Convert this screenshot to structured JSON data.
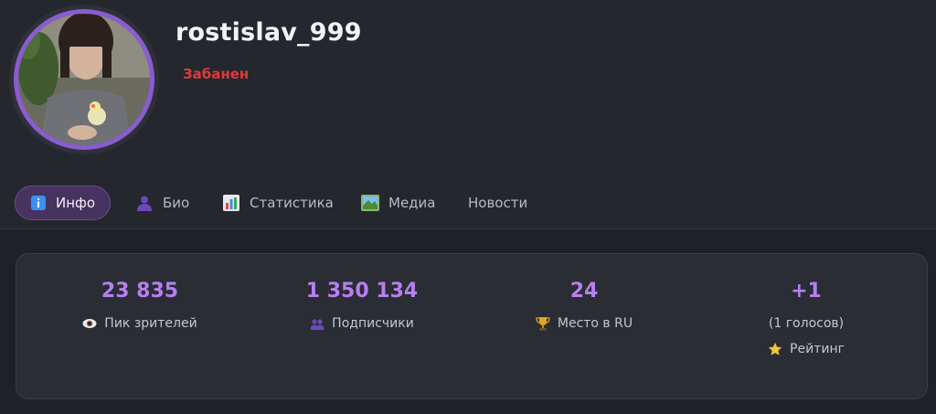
{
  "profile": {
    "username": "rostislav_999",
    "status": "Забанен",
    "status_color": "#e03a3a",
    "accent_color": "#8a5cd1"
  },
  "tabs": [
    {
      "label": "Инфо",
      "icon": "info-icon",
      "active": true
    },
    {
      "label": "Био",
      "icon": "user-icon",
      "active": false
    },
    {
      "label": "Статистика",
      "icon": "bar-chart-icon",
      "active": false
    },
    {
      "label": "Медиа",
      "icon": "image-icon",
      "active": false
    },
    {
      "label": "Новости",
      "icon": "",
      "active": false
    }
  ],
  "stats": [
    {
      "value": "23 835",
      "label": "Пик зрителей",
      "icon": "eye-icon"
    },
    {
      "value": "1 350 134",
      "label": "Подписчики",
      "icon": "users-icon"
    },
    {
      "value": "24",
      "label": "Место в RU",
      "icon": "trophy-icon"
    },
    {
      "value": "+1",
      "label": "(1 голосов)",
      "sub_label": "Рейтинг",
      "icon": "star-icon"
    }
  ]
}
